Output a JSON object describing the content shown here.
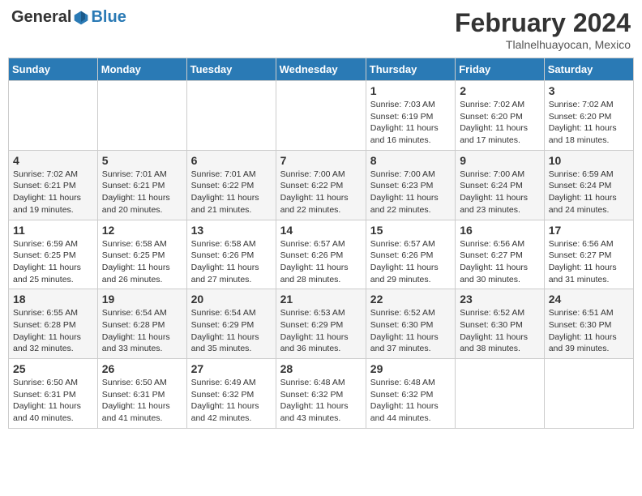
{
  "header": {
    "logo_general": "General",
    "logo_blue": "Blue",
    "month_year": "February 2024",
    "location": "Tlalnelhuayocan, Mexico"
  },
  "weekdays": [
    "Sunday",
    "Monday",
    "Tuesday",
    "Wednesday",
    "Thursday",
    "Friday",
    "Saturday"
  ],
  "weeks": [
    [
      {
        "day": "",
        "info": ""
      },
      {
        "day": "",
        "info": ""
      },
      {
        "day": "",
        "info": ""
      },
      {
        "day": "",
        "info": ""
      },
      {
        "day": "1",
        "info": "Sunrise: 7:03 AM\nSunset: 6:19 PM\nDaylight: 11 hours and 16 minutes."
      },
      {
        "day": "2",
        "info": "Sunrise: 7:02 AM\nSunset: 6:20 PM\nDaylight: 11 hours and 17 minutes."
      },
      {
        "day": "3",
        "info": "Sunrise: 7:02 AM\nSunset: 6:20 PM\nDaylight: 11 hours and 18 minutes."
      }
    ],
    [
      {
        "day": "4",
        "info": "Sunrise: 7:02 AM\nSunset: 6:21 PM\nDaylight: 11 hours and 19 minutes."
      },
      {
        "day": "5",
        "info": "Sunrise: 7:01 AM\nSunset: 6:21 PM\nDaylight: 11 hours and 20 minutes."
      },
      {
        "day": "6",
        "info": "Sunrise: 7:01 AM\nSunset: 6:22 PM\nDaylight: 11 hours and 21 minutes."
      },
      {
        "day": "7",
        "info": "Sunrise: 7:00 AM\nSunset: 6:22 PM\nDaylight: 11 hours and 22 minutes."
      },
      {
        "day": "8",
        "info": "Sunrise: 7:00 AM\nSunset: 6:23 PM\nDaylight: 11 hours and 22 minutes."
      },
      {
        "day": "9",
        "info": "Sunrise: 7:00 AM\nSunset: 6:24 PM\nDaylight: 11 hours and 23 minutes."
      },
      {
        "day": "10",
        "info": "Sunrise: 6:59 AM\nSunset: 6:24 PM\nDaylight: 11 hours and 24 minutes."
      }
    ],
    [
      {
        "day": "11",
        "info": "Sunrise: 6:59 AM\nSunset: 6:25 PM\nDaylight: 11 hours and 25 minutes."
      },
      {
        "day": "12",
        "info": "Sunrise: 6:58 AM\nSunset: 6:25 PM\nDaylight: 11 hours and 26 minutes."
      },
      {
        "day": "13",
        "info": "Sunrise: 6:58 AM\nSunset: 6:26 PM\nDaylight: 11 hours and 27 minutes."
      },
      {
        "day": "14",
        "info": "Sunrise: 6:57 AM\nSunset: 6:26 PM\nDaylight: 11 hours and 28 minutes."
      },
      {
        "day": "15",
        "info": "Sunrise: 6:57 AM\nSunset: 6:26 PM\nDaylight: 11 hours and 29 minutes."
      },
      {
        "day": "16",
        "info": "Sunrise: 6:56 AM\nSunset: 6:27 PM\nDaylight: 11 hours and 30 minutes."
      },
      {
        "day": "17",
        "info": "Sunrise: 6:56 AM\nSunset: 6:27 PM\nDaylight: 11 hours and 31 minutes."
      }
    ],
    [
      {
        "day": "18",
        "info": "Sunrise: 6:55 AM\nSunset: 6:28 PM\nDaylight: 11 hours and 32 minutes."
      },
      {
        "day": "19",
        "info": "Sunrise: 6:54 AM\nSunset: 6:28 PM\nDaylight: 11 hours and 33 minutes."
      },
      {
        "day": "20",
        "info": "Sunrise: 6:54 AM\nSunset: 6:29 PM\nDaylight: 11 hours and 35 minutes."
      },
      {
        "day": "21",
        "info": "Sunrise: 6:53 AM\nSunset: 6:29 PM\nDaylight: 11 hours and 36 minutes."
      },
      {
        "day": "22",
        "info": "Sunrise: 6:52 AM\nSunset: 6:30 PM\nDaylight: 11 hours and 37 minutes."
      },
      {
        "day": "23",
        "info": "Sunrise: 6:52 AM\nSunset: 6:30 PM\nDaylight: 11 hours and 38 minutes."
      },
      {
        "day": "24",
        "info": "Sunrise: 6:51 AM\nSunset: 6:30 PM\nDaylight: 11 hours and 39 minutes."
      }
    ],
    [
      {
        "day": "25",
        "info": "Sunrise: 6:50 AM\nSunset: 6:31 PM\nDaylight: 11 hours and 40 minutes."
      },
      {
        "day": "26",
        "info": "Sunrise: 6:50 AM\nSunset: 6:31 PM\nDaylight: 11 hours and 41 minutes."
      },
      {
        "day": "27",
        "info": "Sunrise: 6:49 AM\nSunset: 6:32 PM\nDaylight: 11 hours and 42 minutes."
      },
      {
        "day": "28",
        "info": "Sunrise: 6:48 AM\nSunset: 6:32 PM\nDaylight: 11 hours and 43 minutes."
      },
      {
        "day": "29",
        "info": "Sunrise: 6:48 AM\nSunset: 6:32 PM\nDaylight: 11 hours and 44 minutes."
      },
      {
        "day": "",
        "info": ""
      },
      {
        "day": "",
        "info": ""
      }
    ]
  ]
}
